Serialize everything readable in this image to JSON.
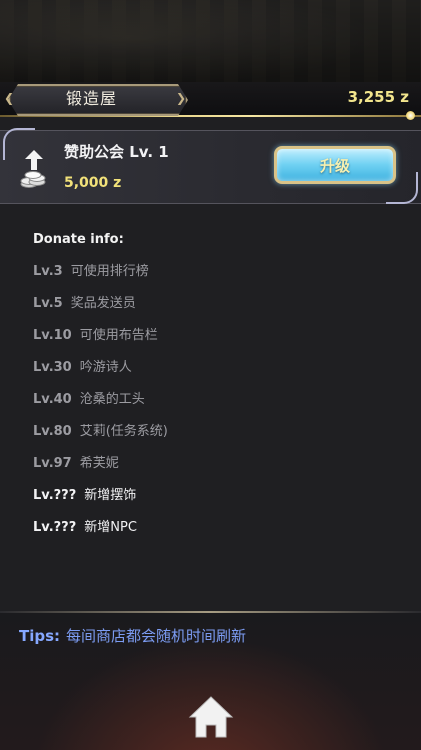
{
  "header": {
    "shop_name": "锻造屋",
    "money": "3,255 z"
  },
  "guild": {
    "title": "赞助公会 Lv. 1",
    "cost": "5,000 z",
    "upgrade_label": "升级"
  },
  "donate": {
    "header": "Donate info:",
    "rows": [
      {
        "level": "Lv.3",
        "reward": "可使用排行榜",
        "state": "done"
      },
      {
        "level": "Lv.5",
        "reward": "奖品发送员",
        "state": "done"
      },
      {
        "level": "Lv.10",
        "reward": "可使用布告栏",
        "state": "done"
      },
      {
        "level": "Lv.30",
        "reward": "吟游诗人",
        "state": "done"
      },
      {
        "level": "Lv.40",
        "reward": "沧桑的工头",
        "state": "done"
      },
      {
        "level": "Lv.80",
        "reward": "艾莉(任务系统)",
        "state": "done"
      },
      {
        "level": "Lv.97",
        "reward": "希芙妮",
        "state": "done"
      },
      {
        "level": "Lv.???",
        "reward": "新增摆饰",
        "state": "next"
      },
      {
        "level": "Lv.???",
        "reward": "新增NPC",
        "state": "next"
      }
    ]
  },
  "tips": {
    "label": "Tips:",
    "text": "每间商店都会随机时间刷新"
  },
  "icons": {
    "upgrade": "upload-arrow-icon",
    "cost": "coins-icon",
    "home": "home-icon"
  },
  "colors": {
    "gold_text": "#f2e58d",
    "tips_blue": "#7c9cf2",
    "button_blue": "#6ed0f2"
  }
}
